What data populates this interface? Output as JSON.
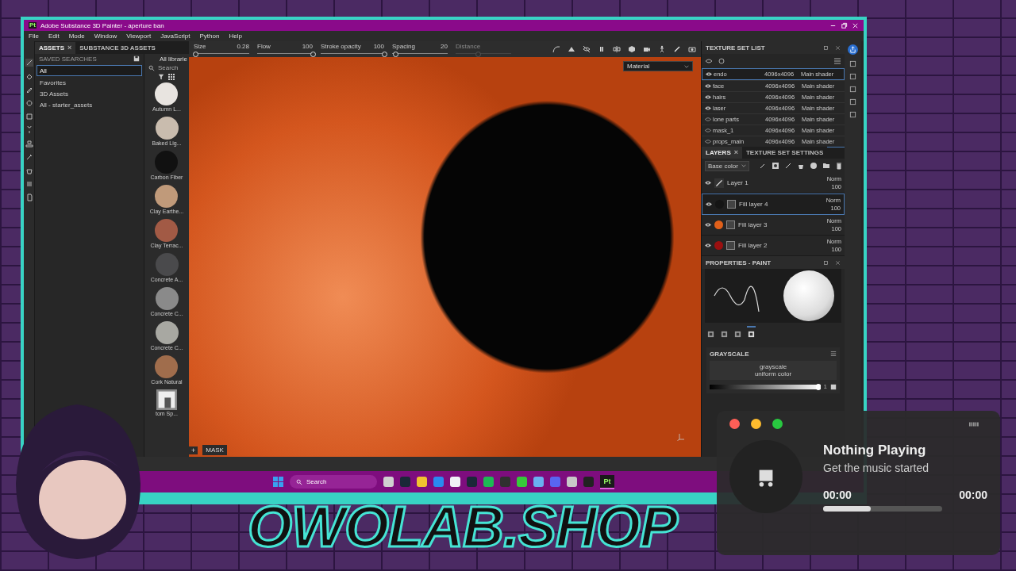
{
  "window": {
    "title": "Adobe Substance 3D Painter - aperture ban",
    "app_badge": "Pt"
  },
  "menu": [
    "File",
    "Edit",
    "Mode",
    "Window",
    "Viewport",
    "JavaScript",
    "Python",
    "Help"
  ],
  "asset_tabs": [
    {
      "label": "ASSETS",
      "selected": true,
      "close": "×"
    },
    {
      "label": "SUBSTANCE 3D ASSETS",
      "selected": false
    }
  ],
  "saved_searches": {
    "heading": "SAVED SEARCHES",
    "search_value": "All",
    "items": [
      "Favorites",
      "3D Assets",
      "All - starter_assets"
    ]
  },
  "library": {
    "title": "All librarie",
    "search_placeholder": "Search",
    "materials": [
      {
        "name": "Autumn L...",
        "color": "#e8e4e0"
      },
      {
        "name": "Baked Lig...",
        "color": "#c9bcae"
      },
      {
        "name": "Carbon Fiber",
        "color": "#111111"
      },
      {
        "name": "Clay Earthe...",
        "color": "#c09a7a"
      },
      {
        "name": "Clay Terrac...",
        "color": "#a25a45"
      },
      {
        "name": "Concrete A...",
        "color": "#4a4a4c"
      },
      {
        "name": "Concrete C...",
        "color": "#8a8a8a"
      },
      {
        "name": "Concrete C...",
        "color": "#a8a8a2"
      },
      {
        "name": "Cork Natural",
        "color": "#a06d4c"
      }
    ],
    "partial_item": "tom Sp..."
  },
  "tool_params": [
    {
      "label": "Size",
      "value": "0.28",
      "level": 0.03,
      "disabled": false
    },
    {
      "label": "Flow",
      "value": "100",
      "level": 1,
      "disabled": false
    },
    {
      "label": "Stroke opacity",
      "value": "100",
      "level": 1,
      "disabled": false
    },
    {
      "label": "Spacing",
      "value": "20",
      "level": 0.05,
      "disabled": false
    },
    {
      "label": "Distance",
      "level": 0.4,
      "disabled": true
    }
  ],
  "viewport": {
    "mode_dropdown": "Material",
    "bottom_tab": "MASK",
    "add_button": "+"
  },
  "texture_set_list": {
    "title": "TEXTURE SET LIST",
    "rows": [
      {
        "name": "endo",
        "resolution": "4096x4096",
        "shader": "Main shader",
        "visible": true,
        "selected": true
      },
      {
        "name": "face",
        "resolution": "4096x4096",
        "shader": "Main shader",
        "visible": true,
        "selected": false
      },
      {
        "name": "hairs",
        "resolution": "4096x4096",
        "shader": "Main shader",
        "visible": true,
        "selected": false
      },
      {
        "name": "laser",
        "resolution": "4096x4096",
        "shader": "Main shader",
        "visible": true,
        "selected": false
      },
      {
        "name": "lone parts",
        "resolution": "4096x4096",
        "shader": "Main shader",
        "visible": false,
        "selected": false
      },
      {
        "name": "mask_1",
        "resolution": "4096x4096",
        "shader": "Main shader",
        "visible": false,
        "selected": false
      },
      {
        "name": "props_main",
        "resolution": "4096x4096",
        "shader": "Main shader",
        "visible": false,
        "selected": false
      }
    ]
  },
  "layer_tabs": [
    {
      "label": "LAYERS",
      "selected": true,
      "close": "×"
    },
    {
      "label": "TEXTURE SET SETTINGS",
      "selected": false
    }
  ],
  "channel_dropdown": "Base color",
  "layers": [
    {
      "name": "Layer 1",
      "kind": "paint",
      "blend": "Norm",
      "opacity": "100",
      "selected": false,
      "visible": true
    },
    {
      "name": "Fill layer 4",
      "kind": "fill",
      "color": "#151515",
      "blend": "Norm",
      "opacity": "100",
      "selected": true,
      "visible": true
    },
    {
      "name": "Fill layer 3",
      "kind": "fill",
      "color": "#e0601a",
      "blend": "Norm",
      "opacity": "100",
      "selected": false,
      "visible": true
    },
    {
      "name": "Fill layer 2",
      "kind": "fill",
      "color": "#9a1010",
      "blend": "Norm",
      "opacity": "100",
      "selected": false,
      "visible": true
    }
  ],
  "properties": {
    "title": "PROPERTIES - PAINT",
    "tabs": [
      {
        "selected": false
      },
      {
        "selected": false
      },
      {
        "selected": false
      },
      {
        "selected": true
      }
    ],
    "section": "GRAYSCALE",
    "source_name": "grayscale",
    "source_type": "uniform color",
    "slider_value": "1",
    "level": 1
  },
  "taskbar": {
    "search_placeholder": "Search",
    "active_app_label": "Pt",
    "apps": [
      {
        "color": "#d0d0d0",
        "active": false
      },
      {
        "color": "#1b2838",
        "active": false
      },
      {
        "color": "#f2c230",
        "active": false
      },
      {
        "color": "#2a8af0",
        "active": false
      },
      {
        "color": "#f0f0f5",
        "active": false
      },
      {
        "color": "#1b2838",
        "active": false
      },
      {
        "color": "#1db954",
        "active": false
      },
      {
        "color": "#303030",
        "active": false
      },
      {
        "color": "#36c93a",
        "active": false
      },
      {
        "color": "#6ab0f0",
        "active": false
      },
      {
        "color": "#5865f2",
        "active": false
      },
      {
        "color": "#c8c8c8",
        "active": false
      },
      {
        "color": "#222222",
        "active": false
      }
    ]
  },
  "music": {
    "title": "Nothing Playing",
    "subtitle": "Get the music started",
    "elapsed": "00:00",
    "total": "00:00",
    "level": 0.4
  },
  "logo": "OWOLAB.SHOP"
}
